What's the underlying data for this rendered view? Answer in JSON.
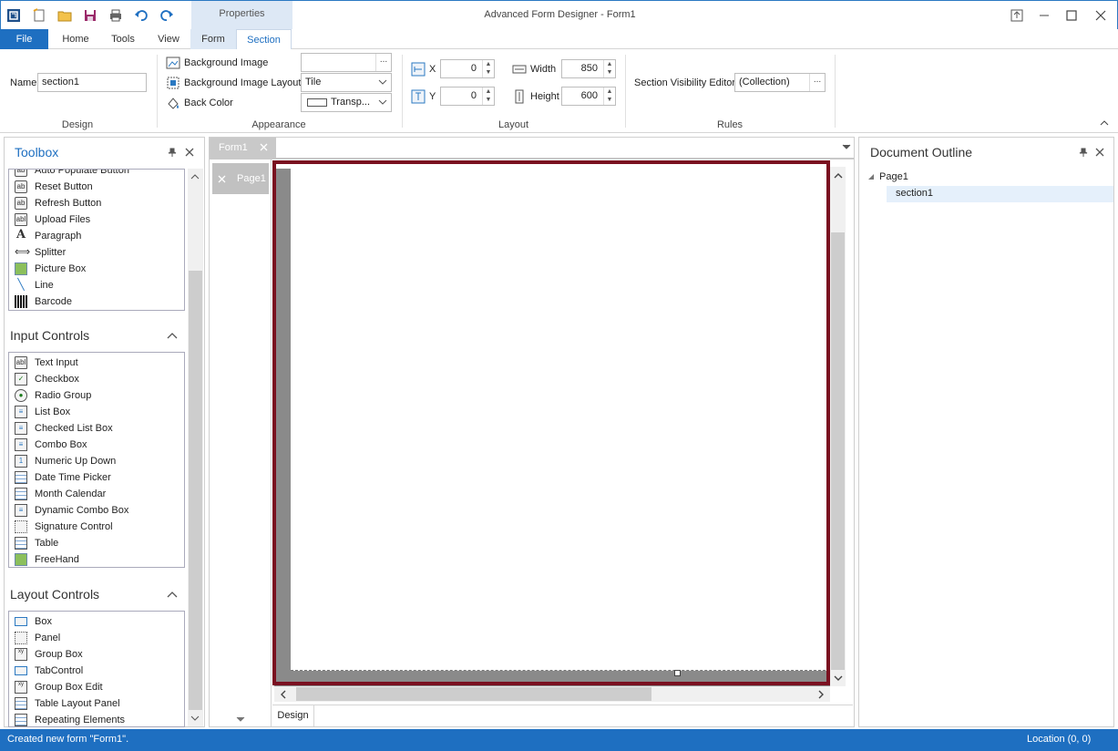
{
  "app": {
    "title": "Advanced Form Designer - Form1",
    "context_tab_group": "Properties"
  },
  "tabs": {
    "file": "File",
    "home": "Home",
    "tools": "Tools",
    "view": "View",
    "form": "Form",
    "section": "Section"
  },
  "ribbon": {
    "design": {
      "label": "Design",
      "name_label": "Name",
      "name_value": "section1"
    },
    "appearance": {
      "label": "Appearance",
      "background_image": "Background Image",
      "background_image_value": "",
      "background_image_layout": "Background Image Layout",
      "background_image_layout_value": "Tile",
      "back_color": "Back Color",
      "back_color_value": "Transp...",
      "ellipsis": "..."
    },
    "layout": {
      "label": "Layout",
      "x_label": "X",
      "x_value": "0",
      "y_label": "Y",
      "y_value": "0",
      "width_label": "Width",
      "width_value": "850",
      "height_label": "Height",
      "height_value": "600"
    },
    "rules": {
      "label": "Rules",
      "section_visibility_editor": "Section Visibility Editor",
      "collection_value": "(Collection)",
      "ellipsis": "..."
    }
  },
  "toolbox": {
    "title": "Toolbox",
    "top_items": [
      {
        "label": "Auto Populate Button",
        "icon": "ab"
      },
      {
        "label": "Reset Button",
        "icon": "ab"
      },
      {
        "label": "Refresh Button",
        "icon": "ab"
      },
      {
        "label": "Upload Files",
        "icon": "abl"
      },
      {
        "label": "Paragraph",
        "icon": "A"
      },
      {
        "label": "Splitter",
        "icon": "+"
      },
      {
        "label": "Picture Box",
        "icon": "img"
      },
      {
        "label": "Line",
        "icon": "\\"
      },
      {
        "label": "Barcode",
        "icon": "|||"
      }
    ],
    "input_controls": {
      "title": "Input Controls",
      "items": [
        {
          "label": "Text Input",
          "icon": "abl"
        },
        {
          "label": "Checkbox",
          "icon": "✓"
        },
        {
          "label": "Radio Group",
          "icon": "◉"
        },
        {
          "label": "List Box",
          "icon": "≡"
        },
        {
          "label": "Checked List Box",
          "icon": "≡"
        },
        {
          "label": "Combo Box",
          "icon": "≡"
        },
        {
          "label": "Numeric Up Down",
          "icon": "1"
        },
        {
          "label": "Date Time Picker",
          "icon": "▦"
        },
        {
          "label": "Month Calendar",
          "icon": "▦"
        },
        {
          "label": "Dynamic Combo Box",
          "icon": "≡"
        },
        {
          "label": "Signature Control",
          "icon": "▢"
        },
        {
          "label": "Table",
          "icon": "▦"
        },
        {
          "label": "FreeHand",
          "icon": "img"
        }
      ]
    },
    "layout_controls": {
      "title": "Layout Controls",
      "items": [
        {
          "label": "Box",
          "icon": "▭"
        },
        {
          "label": "Panel",
          "icon": "▢"
        },
        {
          "label": "Group Box",
          "icon": "xy"
        },
        {
          "label": "TabControl",
          "icon": "▭"
        },
        {
          "label": "Group Box Edit",
          "icon": "xy"
        },
        {
          "label": "Table Layout Panel",
          "icon": "▦"
        },
        {
          "label": "Repeating Elements",
          "icon": "▦"
        }
      ]
    }
  },
  "designer": {
    "doc_tab": "Form1",
    "page_tab": "Page1",
    "bottom_tab": "Design"
  },
  "outline": {
    "title": "Document Outline",
    "page": "Page1",
    "section": "section1"
  },
  "status": {
    "message": "Created new form \"Form1\".",
    "location": "Location (0, 0)"
  },
  "colors": {
    "accent": "#1e6fc1",
    "section_border": "#7a1020"
  }
}
